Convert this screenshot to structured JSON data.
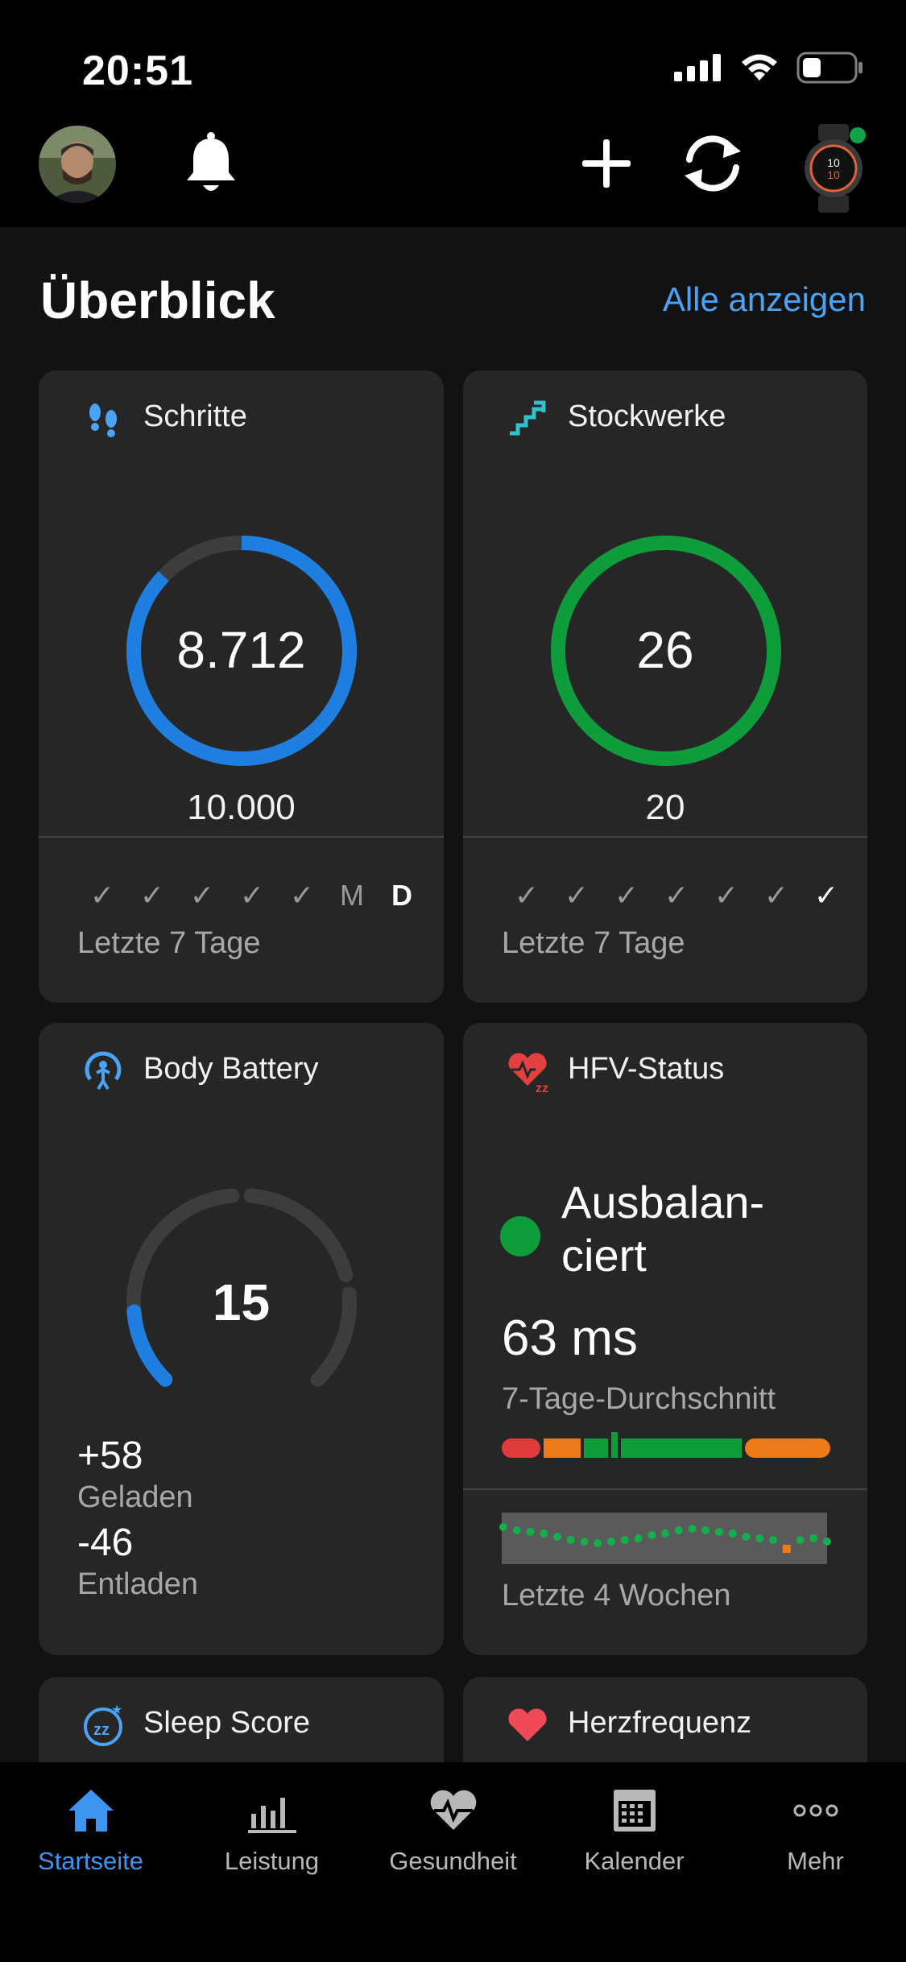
{
  "status_bar": {
    "time": "20:51"
  },
  "header": {
    "title": "Überblick",
    "show_all": "Alle anzeigen"
  },
  "colors": {
    "accent_blue": "#1f7fe0",
    "green": "#0f9d3b",
    "link": "#4aa3f5",
    "card_bg": "#262626"
  },
  "cards": {
    "steps": {
      "title": "Schritte",
      "value": "8.712",
      "goal": "10.000",
      "progress": 0.8712,
      "days": [
        "✓",
        "✓",
        "✓",
        "✓",
        "✓",
        "M",
        "D"
      ],
      "footer": "Letzte 7 Tage"
    },
    "floors": {
      "title": "Stockwerke",
      "value": "26",
      "goal": "20",
      "progress": 1.0,
      "days": [
        "✓",
        "✓",
        "✓",
        "✓",
        "✓",
        "✓",
        "✓"
      ],
      "footer": "Letzte 7 Tage"
    },
    "body_battery": {
      "title": "Body Battery",
      "value": "15",
      "level": 0.15,
      "charged_value": "+58",
      "charged_label": "Geladen",
      "drained_value": "-46",
      "drained_label": "Entladen"
    },
    "hrv": {
      "title": "HFV-Status",
      "status": "Ausbalan-ciert",
      "value": "63 ms",
      "subtitle": "7-Tage-Durchschnitt",
      "footer": "Letzte 4 Wochen"
    },
    "sleep": {
      "title": "Sleep Score"
    },
    "heart_rate": {
      "title": "Herzfrequenz"
    }
  },
  "tabs": [
    {
      "label": "Startseite",
      "icon": "home-icon",
      "active": true
    },
    {
      "label": "Leistung",
      "icon": "bar-chart-icon",
      "active": false
    },
    {
      "label": "Gesundheit",
      "icon": "heart-pulse-icon",
      "active": false
    },
    {
      "label": "Kalender",
      "icon": "calendar-icon",
      "active": false
    },
    {
      "label": "Mehr",
      "icon": "more-icon",
      "active": false
    }
  ]
}
